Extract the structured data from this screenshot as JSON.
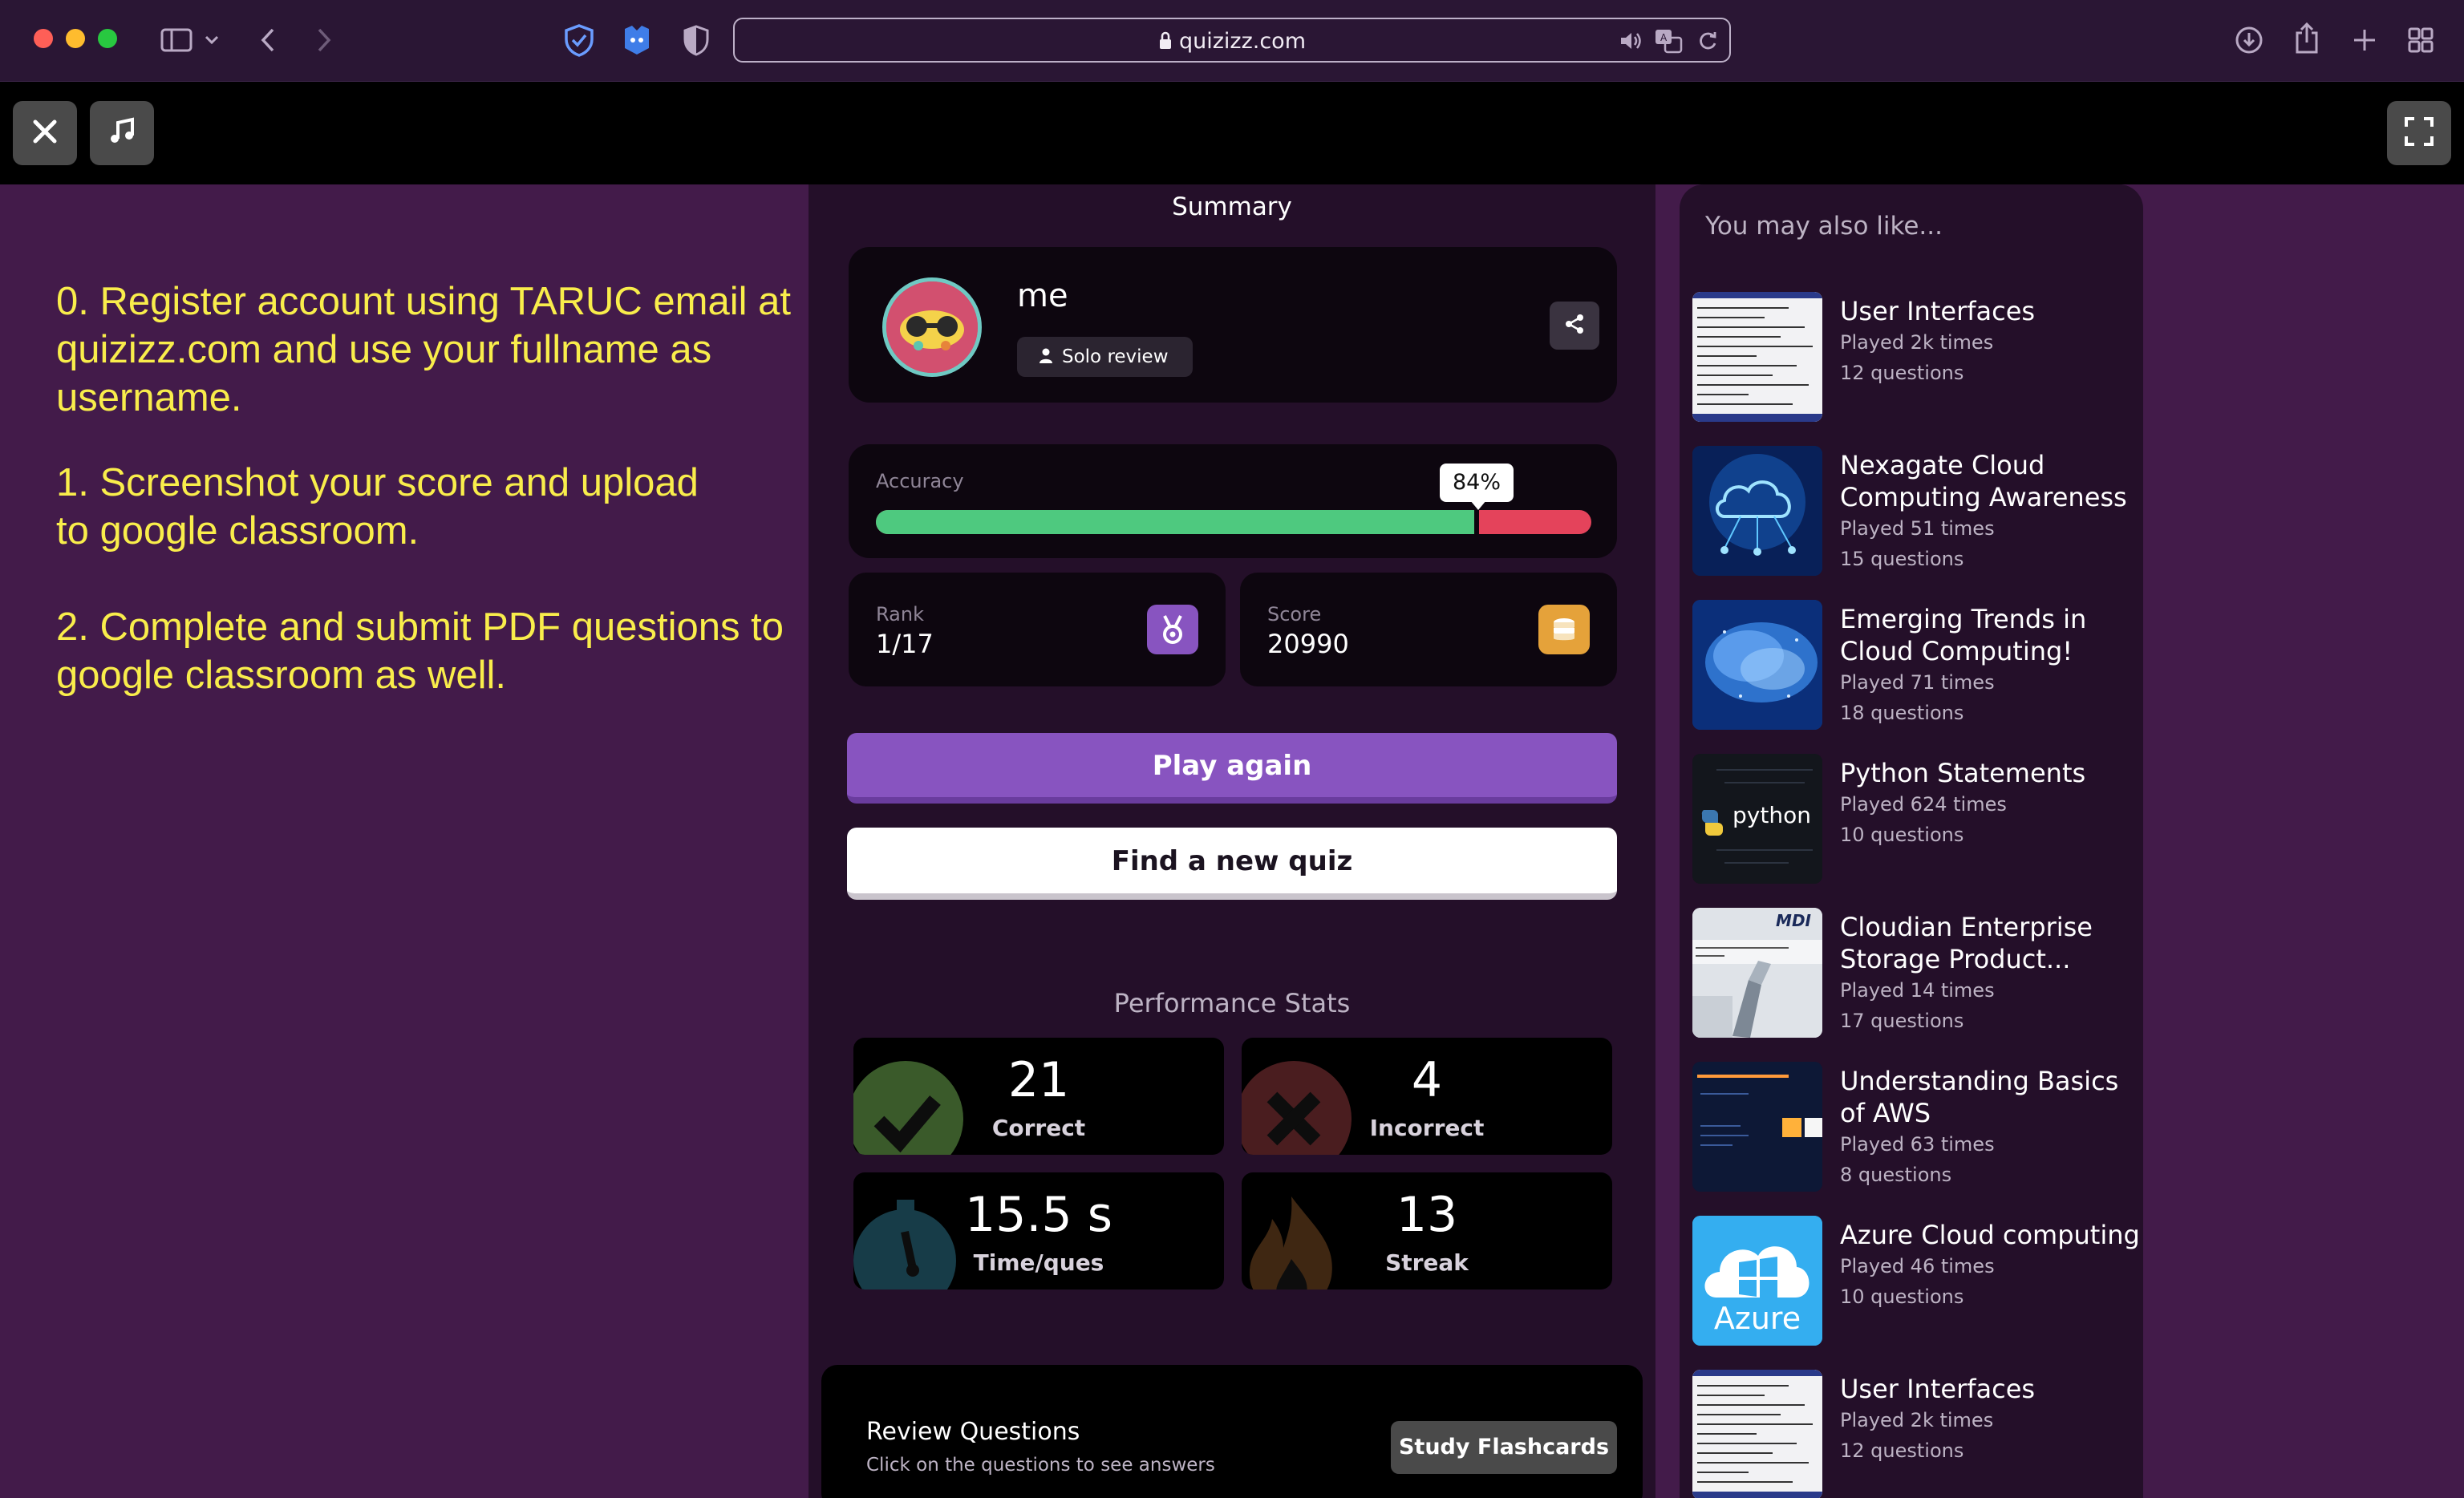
{
  "browser": {
    "url": "quizizz.com"
  },
  "instructions": {
    "item0": "0. Register account using TARUC email at quizizz.com and use your fullname as username.",
    "item1": "1. Screenshot your score and upload to google classroom.",
    "item2": "2. Complete and submit PDF questions to google classroom as well."
  },
  "summary": {
    "title": "Summary",
    "username": "me",
    "mode_badge": "Solo review",
    "accuracy_label": "Accuracy",
    "accuracy_text": "84%",
    "accuracy_value": 0.84,
    "rank_label": "Rank",
    "rank_value": "1/17",
    "score_label": "Score",
    "score_value": "20990",
    "play_again": "Play again",
    "find_quiz": "Find a new quiz"
  },
  "performance": {
    "title": "Performance Stats",
    "correct_value": "21",
    "correct_label": "Correct",
    "incorrect_value": "4",
    "incorrect_label": "Incorrect",
    "time_value": "15.5 s",
    "time_label": "Time/ques",
    "streak_value": "13",
    "streak_label": "Streak"
  },
  "review": {
    "title": "Review Questions",
    "subtitle": "Click on the questions to see answers",
    "flashcards": "Study Flashcards"
  },
  "colors": {
    "accent_purple": "#8854c0",
    "accuracy_green": "#4ec97f",
    "accuracy_red": "#e4435b",
    "instruction_yellow": "#f9ed4b"
  },
  "recommendations": {
    "header": "You may also like...",
    "items": [
      {
        "title": "User Interfaces",
        "played": "Played 2k times",
        "questions": "12 questions",
        "thumb": "code-screenshot"
      },
      {
        "title": "Nexagate Cloud Computing Awareness",
        "played": "Played 51 times",
        "questions": "15 questions",
        "thumb": "cloud-circuit"
      },
      {
        "title": "Emerging Trends in Cloud Computing!",
        "played": "Played 71 times",
        "questions": "18 questions",
        "thumb": "digital-cloud"
      },
      {
        "title": "Python Statements",
        "played": "Played 624 times",
        "questions": "10 questions",
        "thumb": "python-logo",
        "thumb_text": "python"
      },
      {
        "title": "Cloudian Enterprise Storage Product...",
        "played": "Played 14 times",
        "questions": "17 questions",
        "thumb": "storage-slide",
        "thumb_text": "MDI"
      },
      {
        "title": "Understanding Basics of AWS",
        "played": "Played 63 times",
        "questions": "8 questions",
        "thumb": "aws-slide"
      },
      {
        "title": "Azure Cloud computing",
        "played": "Played 46 times",
        "questions": "10 questions",
        "thumb": "azure-logo",
        "thumb_text": "Azure"
      },
      {
        "title": "User Interfaces",
        "played": "Played 2k times",
        "questions": "12 questions",
        "thumb": "code-screenshot"
      }
    ]
  }
}
